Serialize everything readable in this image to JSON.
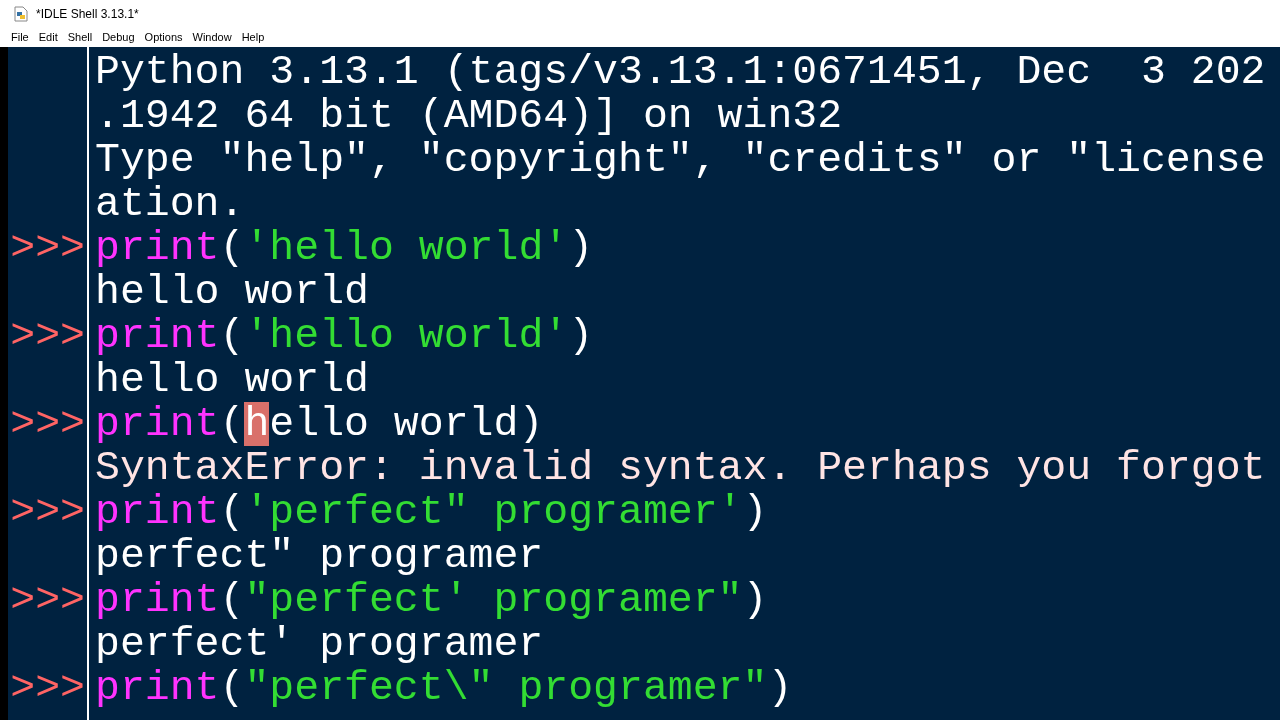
{
  "window": {
    "title": "*IDLE Shell 3.13.1*"
  },
  "menu": [
    "File",
    "Edit",
    "Shell",
    "Debug",
    "Options",
    "Window",
    "Help"
  ],
  "shell_lines": [
    {
      "segments": [
        {
          "kind": "output",
          "text": "Python 3.13.1 (tags/v3.13.1:0671451, Dec  3 202"
        }
      ]
    },
    {
      "segments": [
        {
          "kind": "output",
          "text": ".1942 64 bit (AMD64)] on win32"
        }
      ]
    },
    {
      "segments": [
        {
          "kind": "output",
          "text": "Type \"help\", \"copyright\", \"credits\" or \"license"
        }
      ]
    },
    {
      "segments": [
        {
          "kind": "output",
          "text": "ation."
        }
      ]
    },
    {
      "prompt": ">>>",
      "segments": [
        {
          "kind": "builtin",
          "text": "print"
        },
        {
          "kind": "plain",
          "text": "("
        },
        {
          "kind": "string",
          "text": "'hello world'"
        },
        {
          "kind": "plain",
          "text": ")"
        }
      ]
    },
    {
      "segments": [
        {
          "kind": "output",
          "text": "hello world"
        }
      ]
    },
    {
      "prompt": ">>>",
      "segments": [
        {
          "kind": "builtin",
          "text": "print"
        },
        {
          "kind": "plain",
          "text": "("
        },
        {
          "kind": "string",
          "text": "'hello world'"
        },
        {
          "kind": "plain",
          "text": ")"
        }
      ]
    },
    {
      "segments": [
        {
          "kind": "output",
          "text": "hello world"
        }
      ]
    },
    {
      "prompt": ">>>",
      "segments": [
        {
          "kind": "builtin",
          "text": "print"
        },
        {
          "kind": "plain",
          "text": "("
        },
        {
          "kind": "error_mark",
          "text": "h"
        },
        {
          "kind": "plain",
          "text": "ello world)"
        }
      ]
    },
    {
      "segments": [
        {
          "kind": "error",
          "text": "SyntaxError: invalid syntax. Perhaps you forgot"
        }
      ]
    },
    {
      "prompt": ">>>",
      "segments": [
        {
          "kind": "builtin",
          "text": "print"
        },
        {
          "kind": "plain",
          "text": "("
        },
        {
          "kind": "string",
          "text": "'perfect\" programer'"
        },
        {
          "kind": "plain",
          "text": ")"
        }
      ]
    },
    {
      "segments": [
        {
          "kind": "output",
          "text": "perfect\" programer"
        }
      ]
    },
    {
      "prompt": ">>>",
      "segments": [
        {
          "kind": "builtin",
          "text": "print"
        },
        {
          "kind": "plain",
          "text": "("
        },
        {
          "kind": "string",
          "text": "\"perfect' programer\""
        },
        {
          "kind": "plain",
          "text": ")"
        }
      ]
    },
    {
      "segments": [
        {
          "kind": "output",
          "text": "perfect' programer"
        }
      ]
    },
    {
      "prompt": ">>>",
      "segments": [
        {
          "kind": "builtin",
          "text": "print"
        },
        {
          "kind": "plain",
          "text": "("
        },
        {
          "kind": "string",
          "text": "\"perfect\\\" programer\""
        },
        {
          "kind": "plain",
          "text": ")"
        }
      ]
    }
  ]
}
